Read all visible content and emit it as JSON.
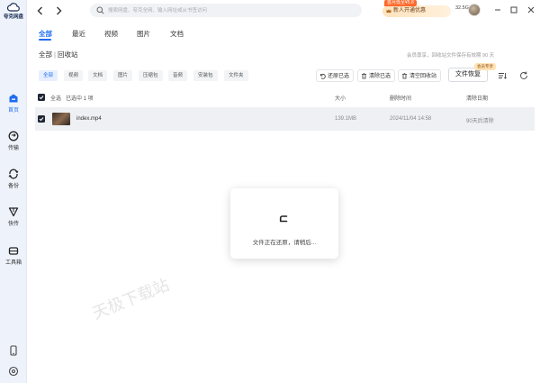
{
  "app": {
    "name": "夸克网盘"
  },
  "sidebar": {
    "items": [
      {
        "label": "首页",
        "icon": "home-icon",
        "active": true
      },
      {
        "label": "传输",
        "icon": "transfer-icon",
        "active": false
      },
      {
        "label": "备份",
        "icon": "backup-icon",
        "active": false
      },
      {
        "label": "快传",
        "icon": "quick-transfer-icon",
        "active": false
      },
      {
        "label": "工具箱",
        "icon": "toolbox-icon",
        "active": false
      }
    ]
  },
  "topbar": {
    "search_placeholder": "搜索网盘、夸克全网、输入网址或从书签访问",
    "promo_tag": "首月低至¥5.8",
    "promo_label": "新人开通优惠",
    "storage": "32.5G/6T"
  },
  "tabs": [
    "全部",
    "最近",
    "视频",
    "图片",
    "文档"
  ],
  "breadcrumb": {
    "root": "全部",
    "separator": "|",
    "current": "回收站"
  },
  "retention_note": "会员尊享，回收站文件保存有效期 90 天",
  "filters": [
    "全部",
    "视频",
    "文档",
    "图片",
    "压缩包",
    "音频",
    "安装包",
    "文件夹"
  ],
  "actions": {
    "restore_selected": "还原已选",
    "delete_selected": "清除已选",
    "empty_bin": "清空回收站",
    "file_recovery": "文件恢复",
    "vip_tag": "会员专享"
  },
  "table": {
    "select_all": "全选",
    "selected_count": "已选中 1 项",
    "col_size": "大小",
    "col_deleted": "删除时间",
    "col_expire": "清除日期",
    "rows": [
      {
        "name": "index.mp4",
        "size": "139.1MB",
        "deleted": "2024/11/04 14:58",
        "expire": "90天后清除"
      }
    ]
  },
  "dialog": {
    "text": "文件正在还原，请稍后..."
  },
  "watermark": "天极下载站",
  "colors": {
    "accent": "#1f6cf2",
    "promo": "#ff6a2c"
  }
}
